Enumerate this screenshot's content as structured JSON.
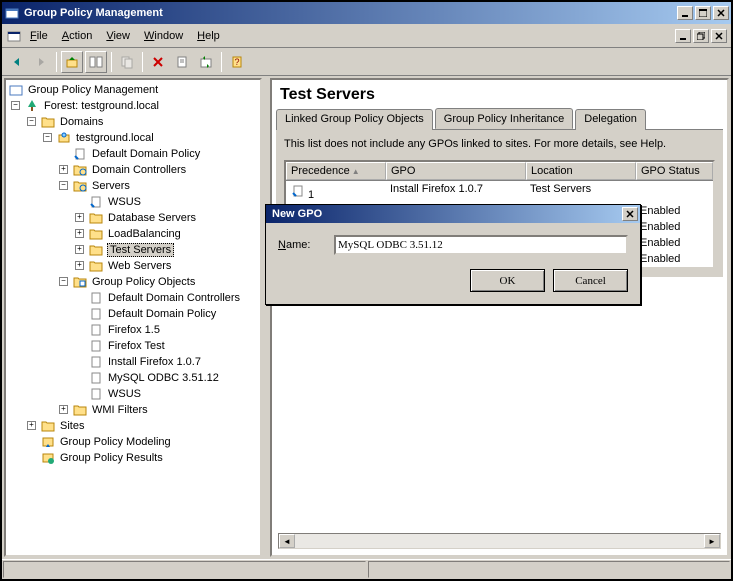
{
  "window": {
    "title": "Group Policy Management"
  },
  "menu": {
    "file": "File",
    "action": "Action",
    "view": "View",
    "window": "Window",
    "help": "Help"
  },
  "tree": {
    "root": "Group Policy Management",
    "forest": "Forest: testground.local",
    "domains": "Domains",
    "domain": "testground.local",
    "default_policy": "Default Domain Policy",
    "dc": "Domain Controllers",
    "servers": "Servers",
    "wsus": "WSUS",
    "db_servers": "Database Servers",
    "loadbalancing": "LoadBalancing",
    "test_servers": "Test Servers",
    "web_servers": "Web Servers",
    "gpo": "Group Policy Objects",
    "gpo_ddc": "Default Domain Controllers",
    "gpo_ddp": "Default Domain Policy",
    "gpo_ff15": "Firefox 1.5",
    "gpo_fftest": "Firefox Test",
    "gpo_iff": "Install Firefox 1.0.7",
    "gpo_mysql": "MySQL ODBC 3.51.12",
    "gpo_wsus": "WSUS",
    "wmi": "WMI Filters",
    "sites": "Sites",
    "gpmodel": "Group Policy Modeling",
    "gpresults": "Group Policy Results"
  },
  "heading": "Test Servers",
  "tabs": {
    "linked": "Linked Group Policy Objects",
    "inherit": "Group Policy Inheritance",
    "delegation": "Delegation"
  },
  "info": "This list does not include any GPOs linked to sites. For more details, see Help.",
  "cols": {
    "precedence": "Precedence",
    "gpo": "GPO",
    "location": "Location",
    "status": "GPO Status"
  },
  "rows": [
    {
      "prec": "1",
      "gpo": "Install Firefox 1.0.7",
      "loc": "Test Servers",
      "status": ""
    },
    {
      "prec": "",
      "gpo": "",
      "loc": "",
      "status": "Enabled"
    },
    {
      "prec": "",
      "gpo": "",
      "loc": "",
      "status": "Enabled"
    },
    {
      "prec": "",
      "gpo": "",
      "loc": "",
      "status": "Enabled"
    },
    {
      "prec": "",
      "gpo": "",
      "loc": "",
      "status": "Enabled"
    }
  ],
  "dialog": {
    "title": "New GPO",
    "name_label": "Name:",
    "name_value": "MySQL ODBC 3.51.12",
    "ok": "OK",
    "cancel": "Cancel"
  }
}
